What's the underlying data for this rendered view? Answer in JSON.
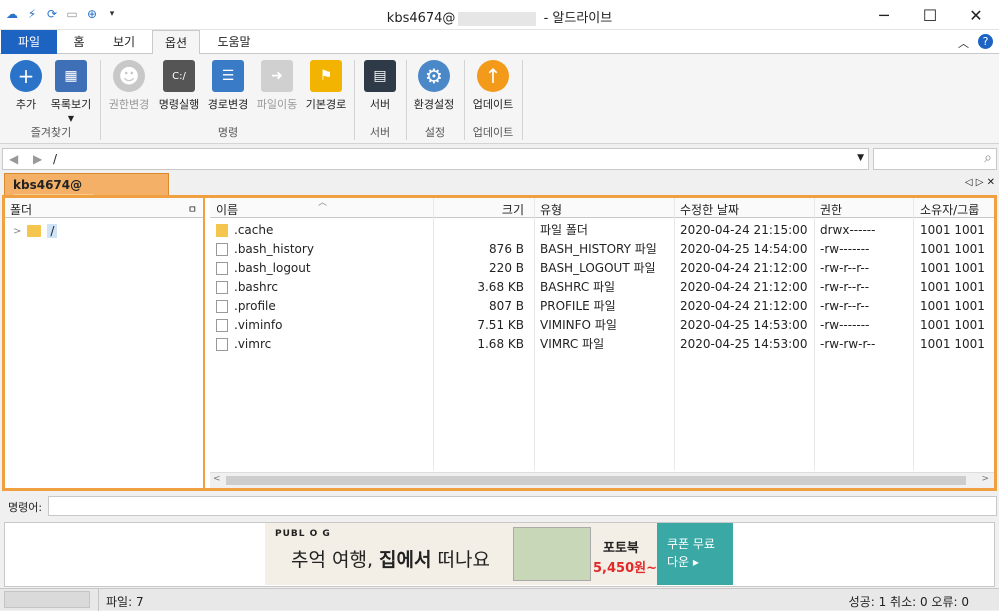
{
  "window": {
    "title_user": "kbs4674@",
    "title_app": " - 알드라이브",
    "minimize": "─",
    "maximize": "☐",
    "close": "✕"
  },
  "ribbon_tabs": [
    "파일",
    "홈",
    "보기",
    "옵션",
    "도움말"
  ],
  "ribbon": {
    "buttons": [
      "추가",
      "목록보기",
      "권한변경",
      "명령실행",
      "경로변경",
      "파일이동",
      "기본경로",
      "서버",
      "환경설정",
      "업데이트"
    ],
    "groups": [
      "즐겨찾기",
      "명령",
      "서버",
      "설정",
      "업데이트"
    ],
    "cmd_icon_text": "C:/"
  },
  "address": {
    "path": "/"
  },
  "session_tab": {
    "label": "kbs4674@"
  },
  "folder_pane": {
    "header": "폴더",
    "pin": "ㅁ",
    "root": "/"
  },
  "files": {
    "columns": [
      "이름",
      "크기",
      "유형",
      "수정한 날짜",
      "권한",
      "소유자/그룹"
    ],
    "rows": [
      {
        "name": ".cache",
        "size": "",
        "type": "파일 폴더",
        "date": "2020-04-24 21:15:00",
        "perm": "drwx------",
        "owner": "1001 1001",
        "icon": "folder-icon"
      },
      {
        "name": ".bash_history",
        "size": "876 B",
        "type": "BASH_HISTORY 파일",
        "date": "2020-04-25 14:54:00",
        "perm": "-rw-------",
        "owner": "1001 1001",
        "icon": "file-icon"
      },
      {
        "name": ".bash_logout",
        "size": "220 B",
        "type": "BASH_LOGOUT 파일",
        "date": "2020-04-24 21:12:00",
        "perm": "-rw-r--r--",
        "owner": "1001 1001",
        "icon": "file-icon"
      },
      {
        "name": ".bashrc",
        "size": "3.68 KB",
        "type": "BASHRC 파일",
        "date": "2020-04-24 21:12:00",
        "perm": "-rw-r--r--",
        "owner": "1001 1001",
        "icon": "file-icon"
      },
      {
        "name": ".profile",
        "size": "807 B",
        "type": "PROFILE 파일",
        "date": "2020-04-24 21:12:00",
        "perm": "-rw-r--r--",
        "owner": "1001 1001",
        "icon": "file-icon"
      },
      {
        "name": ".viminfo",
        "size": "7.51 KB",
        "type": "VIMINFO 파일",
        "date": "2020-04-25 14:53:00",
        "perm": "-rw-------",
        "owner": "1001 1001",
        "icon": "file-icon"
      },
      {
        "name": ".vimrc",
        "size": "1.68 KB",
        "type": "VIMRC 파일",
        "date": "2020-04-25 14:53:00",
        "perm": "-rw-rw-r--",
        "owner": "1001 1001",
        "icon": "file-icon"
      }
    ]
  },
  "command": {
    "label": "명령어:",
    "value": ""
  },
  "ad": {
    "brand": "PUBL O G",
    "headline_1": "추억 여행, ",
    "headline_2": "집에서",
    "headline_3": " 떠나요",
    "product": "포토북",
    "price": "5,450원~",
    "cta": "쿠폰 무료 다운 ▸"
  },
  "statusbar": {
    "files": "파일: 7",
    "result": "성공: 1 취소: 0 오류: 0"
  },
  "colors": {
    "accent": "#1c63c2",
    "session": "#f0a040"
  }
}
